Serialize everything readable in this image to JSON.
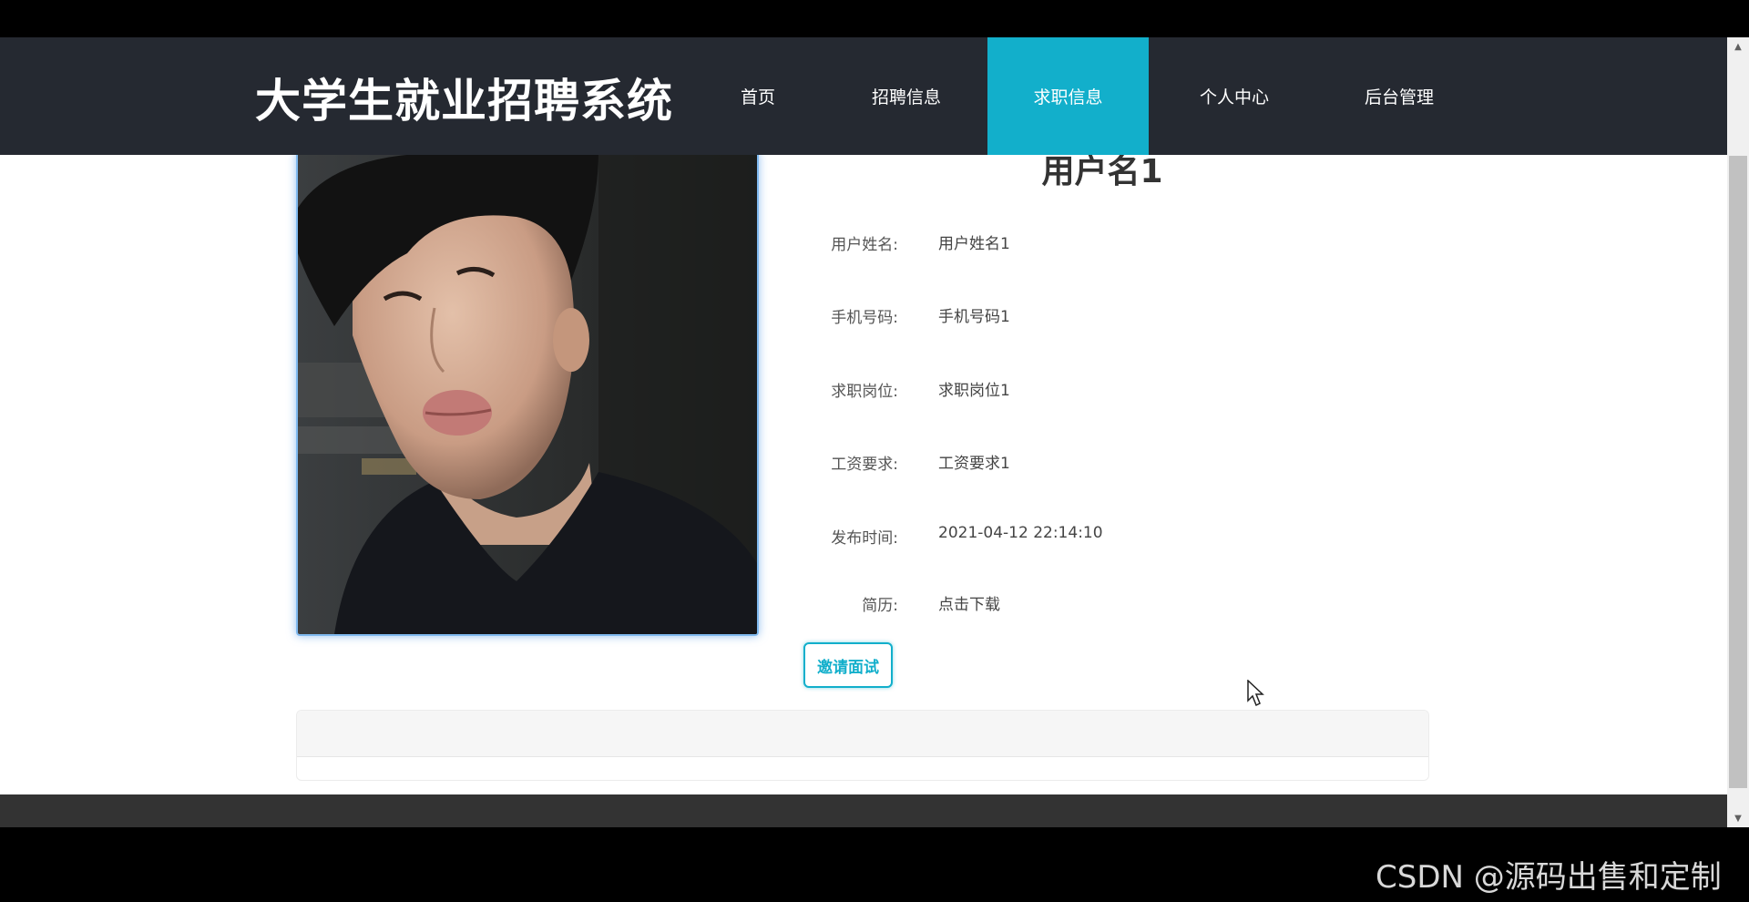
{
  "nav": {
    "site_title": "大学生就业招聘系统",
    "items": [
      {
        "label": "首页"
      },
      {
        "label": "招聘信息"
      },
      {
        "label": "求职信息",
        "active": true
      },
      {
        "label": "个人中心"
      },
      {
        "label": "后台管理"
      }
    ],
    "active_color": "#12afcb",
    "background_color": "#252931"
  },
  "profile": {
    "username": "用户名1",
    "fields": [
      {
        "label": "用户姓名:",
        "value": "用户姓名1"
      },
      {
        "label": "手机号码:",
        "value": "手机号码1"
      },
      {
        "label": "求职岗位:",
        "value": "求职岗位1"
      },
      {
        "label": "工资要求:",
        "value": "工资要求1"
      },
      {
        "label": "发布时间:",
        "value": "2021-04-12 22:14:10"
      },
      {
        "label": "简历:",
        "value": "点击下载"
      }
    ],
    "invite_button": "邀请面试"
  },
  "watermark": "CSDN @源码出售和定制",
  "icons": {
    "scroll_up": "▲",
    "scroll_down": "▼"
  }
}
